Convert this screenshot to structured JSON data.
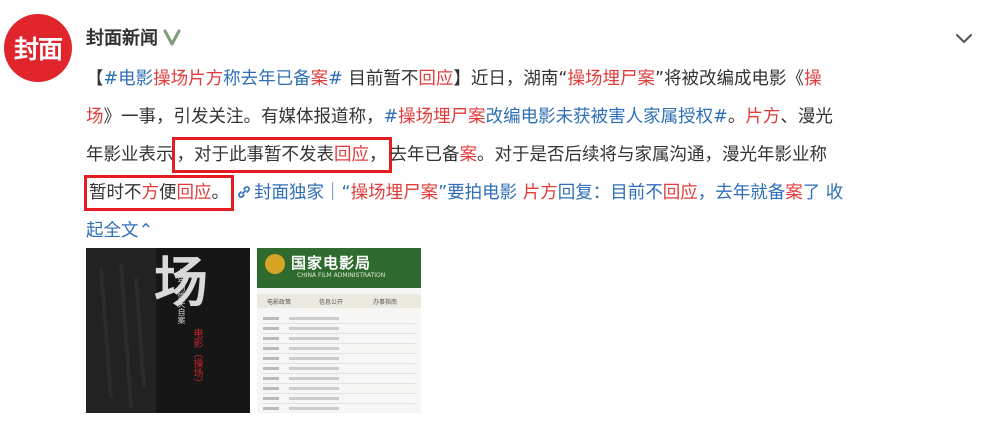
{
  "post": {
    "avatar_text": "封面",
    "author": "封面新闻",
    "verified_icon": "verified-v-badge",
    "menu_icon": "chevron-down-icon"
  },
  "content": {
    "l1": {
      "a": "【",
      "tag1_a": "#电影",
      "tag1_b": "操场片方",
      "tag1_c": "称去年已备",
      "tag1_d": "案",
      "tag1_e": "#",
      "b": " 目前暂不",
      "c": "回应",
      "d": "】近日，湖南“",
      "e": "操场埋尸案",
      "f": "”将被改编成电影《",
      "g": "操"
    },
    "l2": {
      "a": "场",
      "b": "》一事，引发关注。有媒体报道称，",
      "tag2_a": "#",
      "tag2_b": "操场埋尸案",
      "tag2_c": "改编电影未获被害人家属授权#",
      "c": "。",
      "d": "片方",
      "e": "、漫光"
    },
    "l3": {
      "a": "年影业表示",
      "b": "，对于此事暂不发表",
      "c": "回应",
      "d": "，",
      "e": "去年已备",
      "f": "案",
      "g": "。对于是否后续将与家属沟通，漫光年影业称"
    },
    "l4": {
      "a": "暂时不",
      "b": "方",
      "c": "便",
      "d": "回应",
      "e": "。",
      "f": "封面独家｜“",
      "g": "操场埋尸案",
      "h": "”要拍电影 ",
      "i": "片方",
      "j": "回复：目前不",
      "k": "回应",
      "l": "，去年就备",
      "m": "案",
      "n": "了 收"
    },
    "l5": {
      "a": "起全文",
      "b": "⌃"
    }
  },
  "images": {
    "poster": {
      "big_text": "场",
      "red_text": "电影（操场）",
      "white_text": "七年的惨天自案"
    },
    "screenshot": {
      "title": "国家电影局",
      "subtitle": "CHINA FILM ADMINISTRATION",
      "nav_items": [
        "电影政策",
        "信息公开",
        "办事指南"
      ]
    }
  },
  "colors": {
    "link": "#2f6fb7",
    "highlight": "#e23b3b",
    "box": "#e51c23",
    "avatar": "#e0252c"
  }
}
